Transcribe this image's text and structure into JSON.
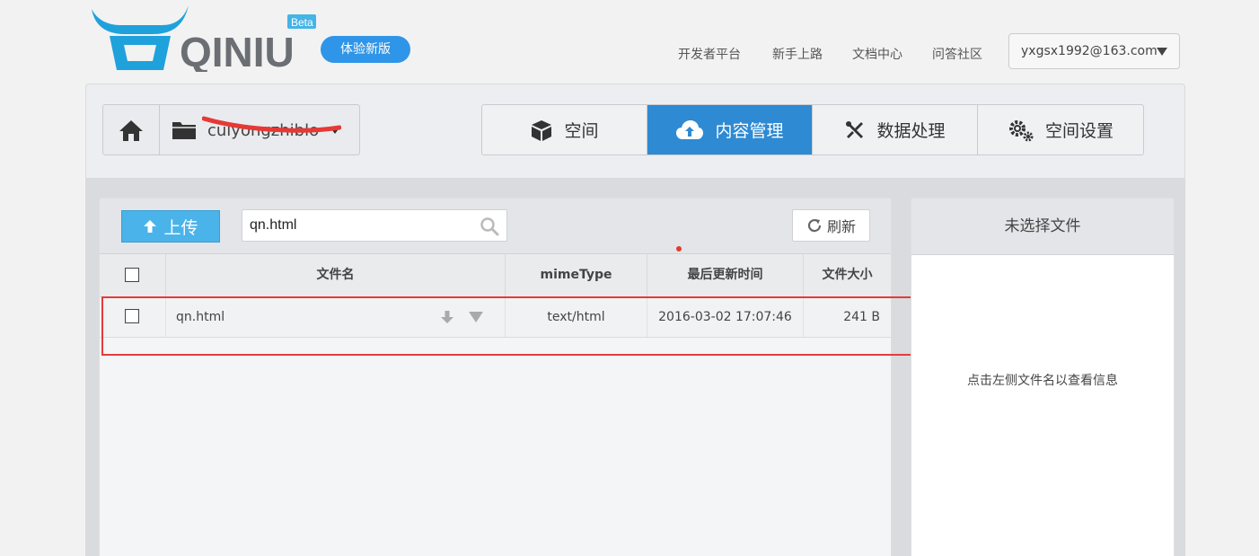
{
  "header": {
    "logo_text": "QINIU",
    "logo_badge": "Beta",
    "try_new_label": "体验新版",
    "nav": [
      {
        "label": "开发者平台"
      },
      {
        "label": "新手上路"
      },
      {
        "label": "文档中心"
      },
      {
        "label": "问答社区"
      }
    ],
    "user_email": "yxgsx1992@163.com"
  },
  "bucket": {
    "name": "cuiyongzhibloq"
  },
  "tabs": [
    {
      "label": "空间",
      "icon": "box-icon",
      "active": false
    },
    {
      "label": "内容管理",
      "icon": "cloud-upload-icon",
      "active": true
    },
    {
      "label": "数据处理",
      "icon": "tools-icon",
      "active": false
    },
    {
      "label": "空间设置",
      "icon": "gears-icon",
      "active": false
    }
  ],
  "toolbar": {
    "upload_label": "上传",
    "search_value": "qn.html",
    "refresh_label": "刷新"
  },
  "table": {
    "columns": [
      "文件名",
      "mimeType",
      "最后更新时间",
      "文件大小"
    ],
    "rows": [
      {
        "name": "qn.html",
        "mime": "text/html",
        "updated": "2016-03-02 17:07:46",
        "size": "241 B"
      }
    ]
  },
  "info_panel": {
    "title": "未选择文件",
    "hint": "点击左侧文件名以查看信息"
  },
  "colors": {
    "accent": "#2e8ad3",
    "upload": "#4ab3ea",
    "highlight": "#e53b3b"
  }
}
